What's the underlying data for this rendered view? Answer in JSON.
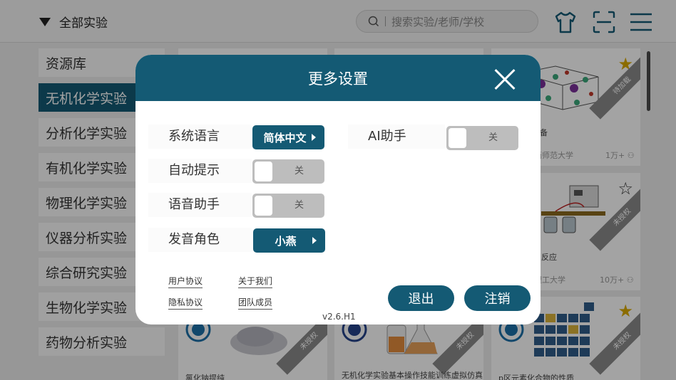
{
  "header": {
    "filter_label": "全部实验",
    "search_placeholder": "搜索实验/老师/学校"
  },
  "sidebar": {
    "items": [
      {
        "label": "资源库"
      },
      {
        "label": "无机化学实验"
      },
      {
        "label": "分析化学实验"
      },
      {
        "label": "有机化学实验"
      },
      {
        "label": "物理化学实验"
      },
      {
        "label": "仪器分析实验"
      },
      {
        "label": "综合研究实验"
      },
      {
        "label": "生物化学实验"
      },
      {
        "label": "药物分析实验"
      }
    ],
    "active_index": 1
  },
  "cards": [
    {
      "title": "备",
      "school": "西师范大学",
      "count": "1万+",
      "badge": "待加载",
      "favorited": true
    },
    {
      "title": "反应",
      "school": "理工大学",
      "count": "10万+",
      "badge": "未授权",
      "favorited": false
    },
    {
      "title": "氯化钠提纯",
      "badge": "未授权",
      "favorited": false
    },
    {
      "title": "无机化学实验基本操作技能训练虚拟仿真",
      "badge": "未授权",
      "favorited": false
    },
    {
      "title": "p区元素化合物的性质",
      "badge": "未授权",
      "favorited": true
    }
  ],
  "dialog": {
    "title": "更多设置",
    "settings": {
      "language": {
        "label": "系统语言",
        "value": "简体中文"
      },
      "auto_hint": {
        "label": "自动提示",
        "value": "关"
      },
      "voice_assistant": {
        "label": "语音助手",
        "value": "关"
      },
      "voice_role": {
        "label": "发音角色",
        "value": "小燕"
      },
      "ai_assistant": {
        "label": "AI助手",
        "value": "关"
      }
    },
    "links": {
      "user_agreement": "用户协议",
      "about_us": "关于我们",
      "privacy": "隐私协议",
      "team": "团队成员"
    },
    "version": "v2.6.H1",
    "logout_label": "退出",
    "cancel_account_label": "注销"
  },
  "colors": {
    "accent": "#145a74",
    "toggle_off": "#bdbdbd"
  }
}
